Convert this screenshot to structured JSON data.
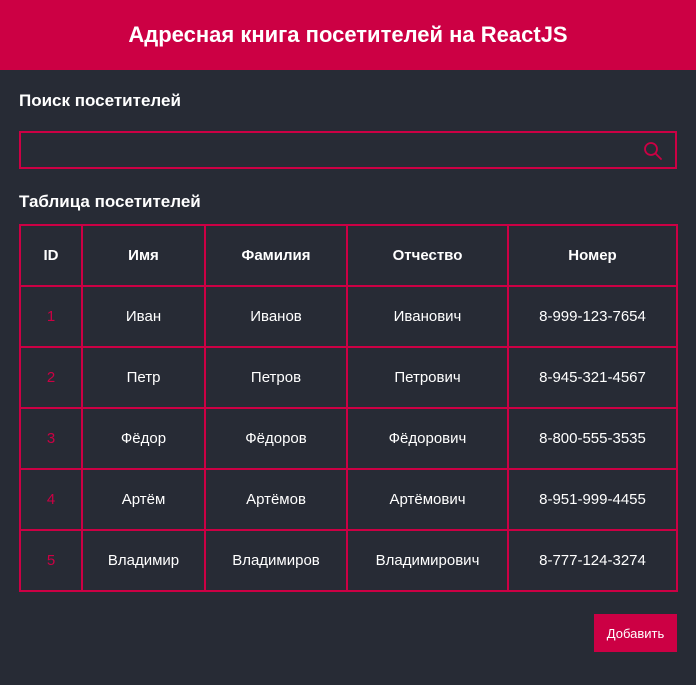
{
  "header": {
    "title": "Адресная книга посетителей на ReactJS"
  },
  "search": {
    "title": "Поиск посетителей",
    "value": "",
    "placeholder": ""
  },
  "table": {
    "title": "Таблица посетителей",
    "columns": [
      "ID",
      "Имя",
      "Фамилия",
      "Отчество",
      "Номер"
    ],
    "rows": [
      {
        "id": "1",
        "first": "Иван",
        "last": "Иванов",
        "middle": "Иванович",
        "phone": "8-999-123-7654"
      },
      {
        "id": "2",
        "first": "Петр",
        "last": "Петров",
        "middle": "Петрович",
        "phone": "8-945-321-4567"
      },
      {
        "id": "3",
        "first": "Фёдор",
        "last": "Фёдоров",
        "middle": "Фёдорович",
        "phone": "8-800-555-3535"
      },
      {
        "id": "4",
        "first": "Артём",
        "last": "Артёмов",
        "middle": "Артёмович",
        "phone": "8-951-999-4455"
      },
      {
        "id": "5",
        "first": "Владимир",
        "last": "Владимиров",
        "middle": "Владимирович",
        "phone": "8-777-124-3274"
      }
    ]
  },
  "actions": {
    "add_label": "Добавить"
  },
  "colors": {
    "accent": "#cc0044",
    "background": "#272b35"
  }
}
